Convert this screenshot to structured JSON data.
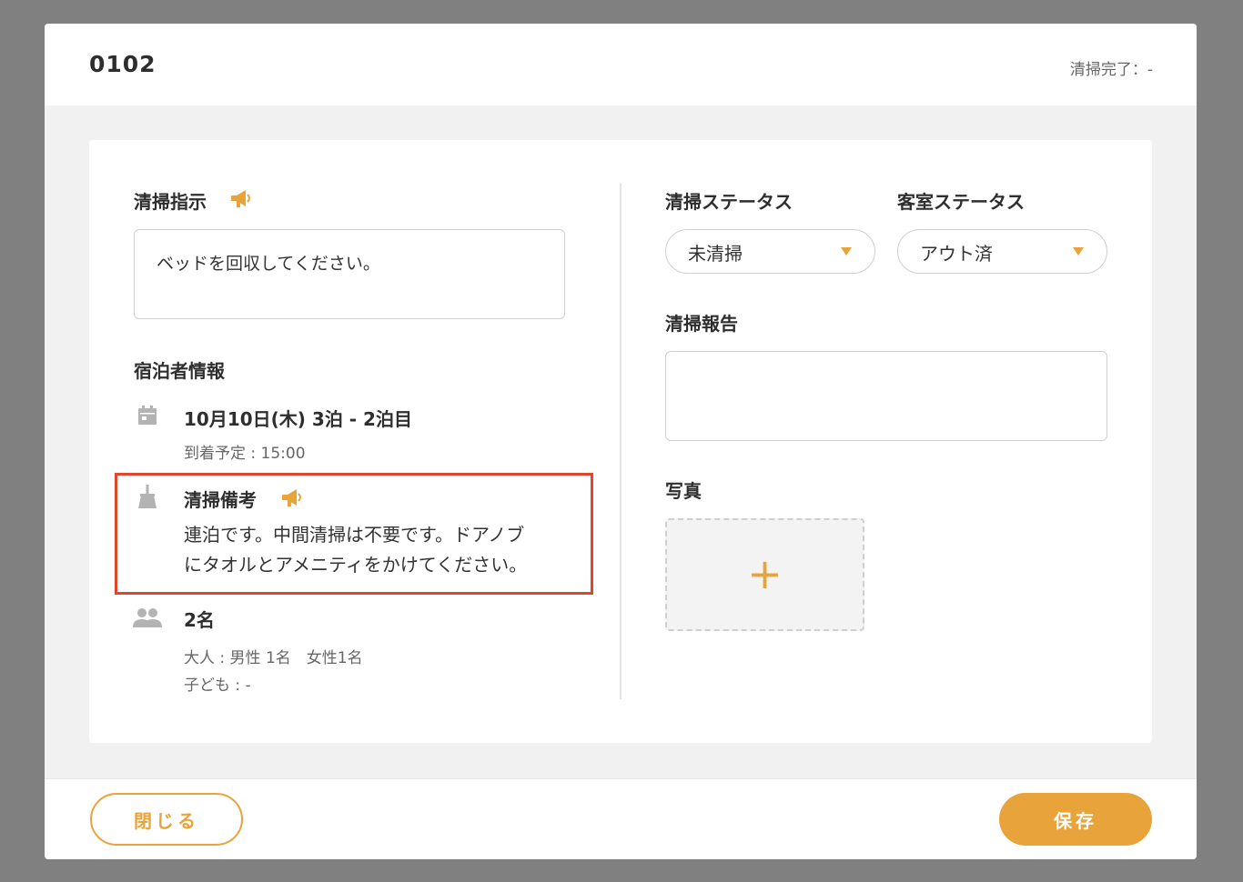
{
  "header": {
    "room_number": "0102",
    "cleaning_done_label": "清掃完了：-"
  },
  "left": {
    "instruction_title": "清掃指示",
    "instruction_text": "ベッドを回収してください。",
    "guest_info_title": "宿泊者情報",
    "stay_dates": "10月10日(木) 3泊 - 2泊目",
    "arrival": "到着予定 : 15:00",
    "cleaning_memo_title": "清掃備考",
    "cleaning_memo_line1": "連泊です。中間清掃は不要です。ドアノブ",
    "cleaning_memo_line2": "にタオルとアメニティをかけてください。",
    "guest_count": "2名",
    "adults": "大人 : 男性 1名　女性1名",
    "children": "子ども : -"
  },
  "right": {
    "cleaning_status_label": "清掃ステータス",
    "cleaning_status_value": "未清掃",
    "room_status_label": "客室ステータス",
    "room_status_value": "アウト済",
    "report_label": "清掃報告",
    "report_value": "",
    "photo_label": "写真",
    "photo_add": "+"
  },
  "footer": {
    "close_label": "閉じる",
    "save_label": "保存"
  },
  "colors": {
    "accent": "#e8a33a",
    "highlight": "#e0452e",
    "icon_gray": "#b3b3b3"
  },
  "icons": [
    "megaphone-icon",
    "calendar-icon",
    "broom-icon",
    "people-icon",
    "dropdown-caret-icon",
    "plus-icon"
  ]
}
